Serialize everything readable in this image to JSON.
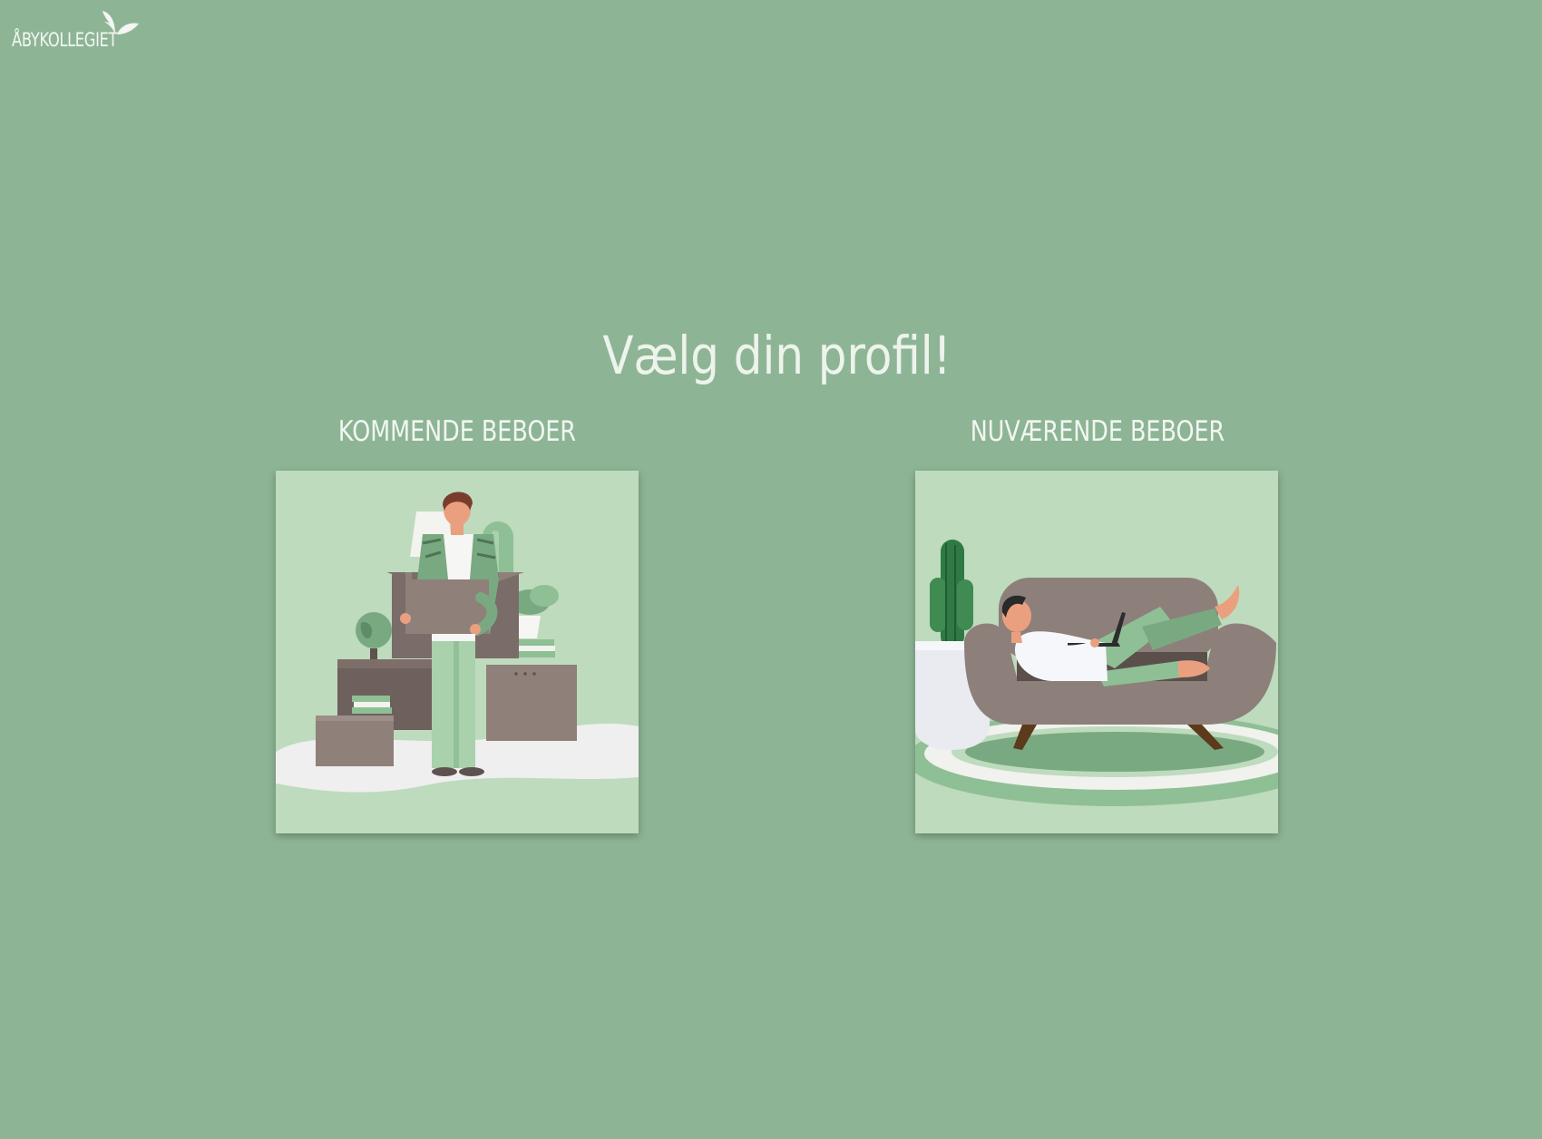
{
  "header": {
    "logo_text": "ÅBYKOLLEGIET",
    "logo_icon": "leaf-icon"
  },
  "main": {
    "title": "Vælg din profil!",
    "options": [
      {
        "label": "KOMMENDE BEBOER",
        "illustration": "person-moving-boxes-illustration"
      },
      {
        "label": "NUVÆRENDE BEBOER",
        "illustration": "person-on-sofa-laptop-illustration"
      }
    ]
  },
  "colors": {
    "background": "#8db595",
    "card_background": "#bedbbd",
    "text": "#eef3ec",
    "box_brown": "#8f807a",
    "sofa": "#8d807b"
  }
}
